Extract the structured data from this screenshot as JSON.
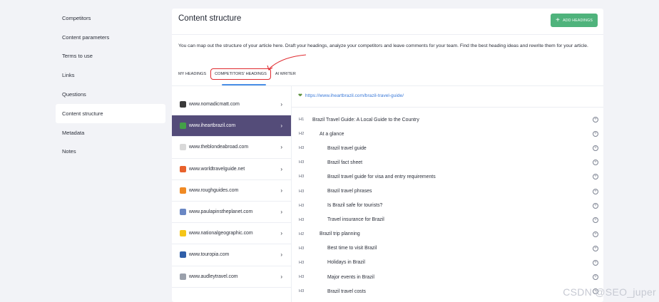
{
  "sidebar": {
    "items": [
      {
        "label": "Competitors"
      },
      {
        "label": "Content parameters"
      },
      {
        "label": "Terms to use"
      },
      {
        "label": "Links"
      },
      {
        "label": "Questions"
      },
      {
        "label": "Content structure",
        "active": true
      },
      {
        "label": "Metadata"
      },
      {
        "label": "Notes"
      }
    ]
  },
  "main": {
    "title": "Content structure",
    "add_button": "ADD HEADINGS",
    "description": "You can map out the structure of your article here. Draft your headings, analyze your competitors and leave comments for your team. Find the best heading ideas and rewrite them for your article.",
    "tabs": [
      "MY HEADINGS",
      "COMPETITORS' HEADINGS",
      "AI WRITER"
    ],
    "active_tab": "COMPETITORS' HEADINGS"
  },
  "competitors": [
    {
      "site": "www.nomadicmatt.com",
      "color": "#3a3a3a"
    },
    {
      "site": "www.iheartbrazil.com",
      "color": "#43a047",
      "active": true
    },
    {
      "site": "www.theblondeabroad.com",
      "color": "#d9d9d9"
    },
    {
      "site": "www.worldtravelguide.net",
      "color": "#e8622c"
    },
    {
      "site": "www.roughguides.com",
      "color": "#f08a24"
    },
    {
      "site": "www.paulapinstheplanet.com",
      "color": "#6a87c4"
    },
    {
      "site": "www.nationalgeographic.com",
      "color": "#f5c518"
    },
    {
      "site": "www.touropia.com",
      "color": "#2f5ea8"
    },
    {
      "site": "www.audleytravel.com",
      "color": "#9aa0ab"
    }
  ],
  "selected_url": "https://www.iheartbrazil.com/brazil-travel-guide/",
  "headings": [
    {
      "tag": "H1",
      "text": "Brazil Travel Guide: A Local Guide to the Country",
      "level": 1
    },
    {
      "tag": "H2",
      "text": "At a glance",
      "level": 2
    },
    {
      "tag": "H3",
      "text": "Brazil travel guide",
      "level": 3
    },
    {
      "tag": "H3",
      "text": "Brazil fact sheet",
      "level": 3
    },
    {
      "tag": "H3",
      "text": "Brazil travel guide for visa and entry requirements",
      "level": 3
    },
    {
      "tag": "H3",
      "text": "Brazil travel phrases",
      "level": 3
    },
    {
      "tag": "H3",
      "text": "Is Brazil safe for tourists?",
      "level": 3
    },
    {
      "tag": "H3",
      "text": "Travel insurance for Brazil",
      "level": 3
    },
    {
      "tag": "H2",
      "text": "Brazil trip planning",
      "level": 2
    },
    {
      "tag": "H3",
      "text": "Best time to visit Brazil",
      "level": 3
    },
    {
      "tag": "H3",
      "text": "Holidays in Brazil",
      "level": 3
    },
    {
      "tag": "H3",
      "text": "Major events in Brazil",
      "level": 3
    },
    {
      "tag": "H3",
      "text": "Brazil travel costs",
      "level": 3
    }
  ],
  "watermark": "CSDN @SEO_juper",
  "colors": {
    "accent_green": "#4fb37c",
    "active_site": "#544c79",
    "highlight_red": "#e0292e",
    "link_blue": "#3b7ad9"
  }
}
